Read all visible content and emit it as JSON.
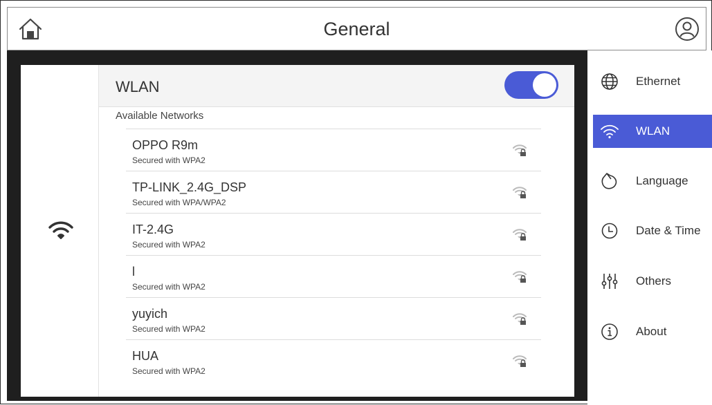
{
  "header": {
    "title": "General"
  },
  "wlan": {
    "title": "WLAN",
    "enabled": true,
    "available_label": "Available Networks",
    "networks": [
      {
        "name": "OPPO R9m",
        "security": "Secured with WPA2"
      },
      {
        "name": "TP-LINK_2.4G_DSP",
        "security": "Secured with WPA/WPA2"
      },
      {
        "name": "IT-2.4G",
        "security": "Secured with WPA2"
      },
      {
        "name": "l",
        "security": "Secured with WPA2"
      },
      {
        "name": "yuyich",
        "security": "Secured with WPA2"
      },
      {
        "name": "HUA",
        "security": "Secured with WPA2"
      }
    ]
  },
  "nav": {
    "items": [
      {
        "label": "Ethernet",
        "icon": "globe-icon"
      },
      {
        "label": "WLAN",
        "icon": "wifi-icon",
        "active": true
      },
      {
        "label": "Language",
        "icon": "language-icon"
      },
      {
        "label": "Date & Time",
        "icon": "clock-icon"
      },
      {
        "label": "Others",
        "icon": "sliders-icon"
      },
      {
        "label": "About",
        "icon": "info-icon"
      }
    ]
  },
  "colors": {
    "accent": "#4a5bd6",
    "dark_panel": "#1f1f1f"
  }
}
